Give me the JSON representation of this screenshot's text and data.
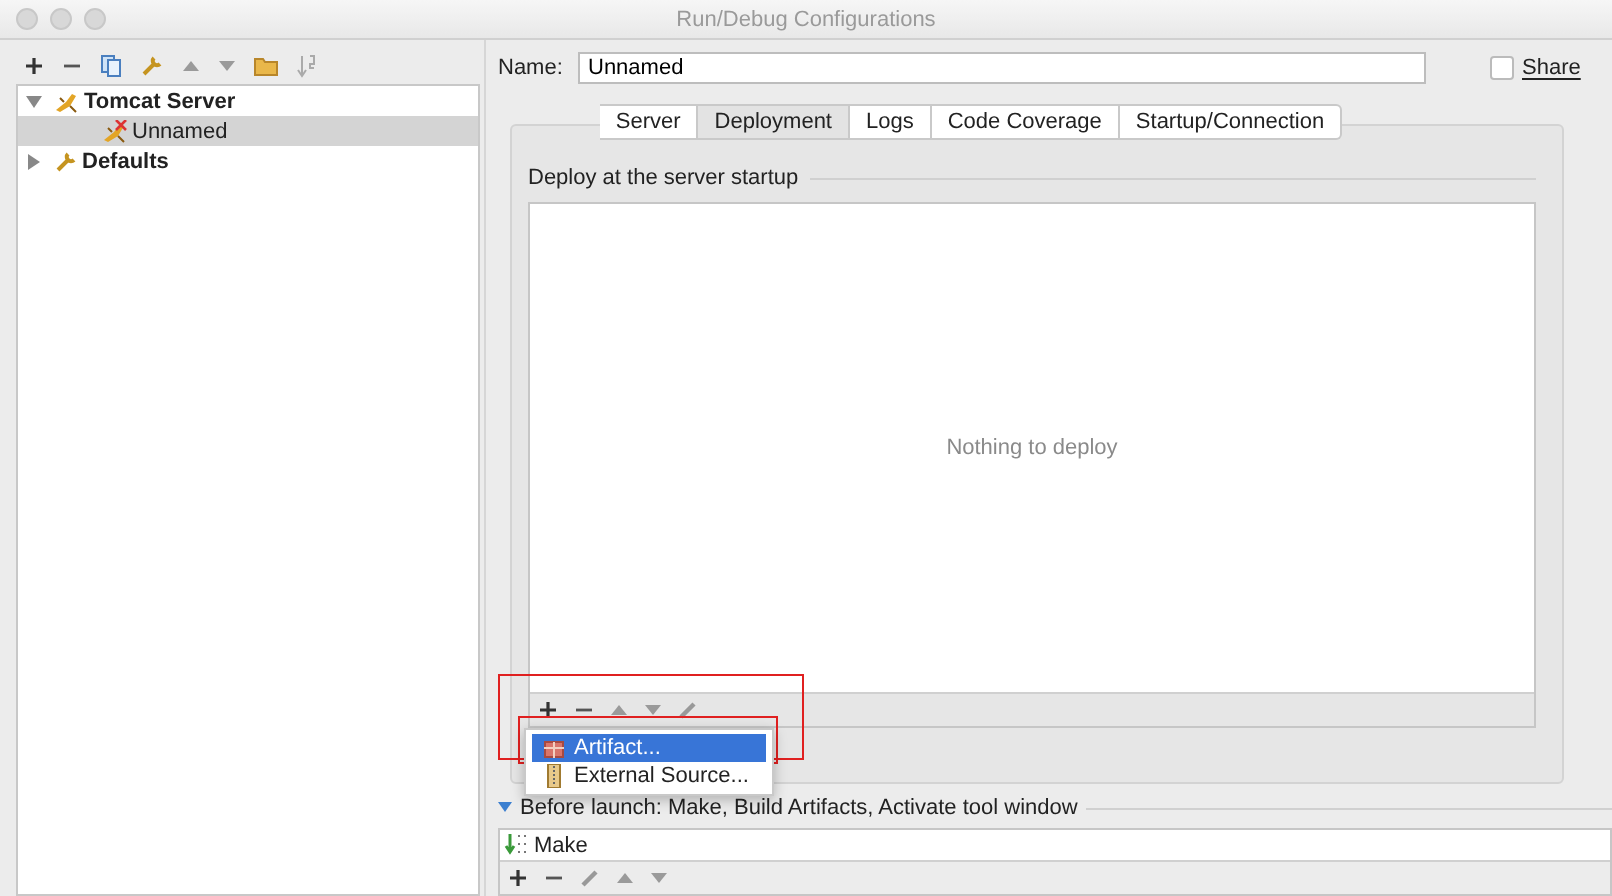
{
  "window": {
    "title": "Run/Debug Configurations"
  },
  "tree": [
    {
      "label": "Tomcat Server",
      "kind": "server",
      "expanded": true,
      "selected": false,
      "children": [
        {
          "label": "Unnamed",
          "kind": "config",
          "selected": true
        }
      ]
    },
    {
      "label": "Defaults",
      "kind": "defaults",
      "expanded": false,
      "selected": false
    }
  ],
  "name_field": {
    "label": "Name:",
    "value": "Unnamed"
  },
  "share": {
    "label": "Share",
    "checked": false
  },
  "tabs": [
    {
      "label": "Server",
      "selected": false
    },
    {
      "label": "Deployment",
      "selected": true
    },
    {
      "label": "Logs",
      "selected": false
    },
    {
      "label": "Code Coverage",
      "selected": false
    },
    {
      "label": "Startup/Connection",
      "selected": false
    }
  ],
  "deployment": {
    "heading": "Deploy at the server startup",
    "empty_text": "Nothing to deploy"
  },
  "add_menu": [
    {
      "label": "Artifact...",
      "kind": "artifact",
      "selected": true
    },
    {
      "label": "External Source...",
      "kind": "external",
      "selected": false
    }
  ],
  "before_launch": {
    "label": "Before launch: Make, Build Artifacts, Activate tool window",
    "expanded": true,
    "tasks": [
      {
        "label": "Make"
      }
    ]
  }
}
